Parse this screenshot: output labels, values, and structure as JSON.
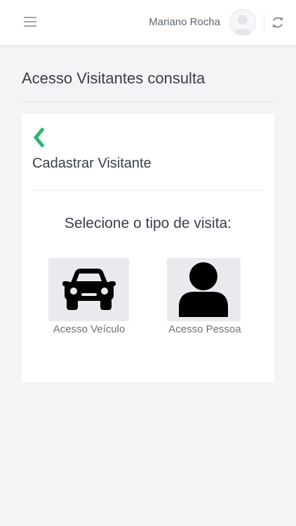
{
  "header": {
    "menu_icon": "hamburger-menu-icon",
    "user_name": "Mariano Rocha",
    "avatar_icon": "default-user-avatar",
    "refresh_icon": "refresh-icon"
  },
  "page": {
    "title": "Acesso Visitantes consulta"
  },
  "card": {
    "back_icon": "chevron-left-icon",
    "title": "Cadastrar Visitante",
    "prompt": "Selecione o tipo de visita:",
    "options": [
      {
        "label": "Acesso Veículo",
        "icon": "car-icon"
      },
      {
        "label": "Acesso Pessoa",
        "icon": "person-icon"
      }
    ]
  },
  "colors": {
    "accent_green": "#2bb673",
    "background": "#f3f4f6",
    "card": "#ffffff",
    "tile": "#e8eaee",
    "text": "#3a3f47"
  }
}
